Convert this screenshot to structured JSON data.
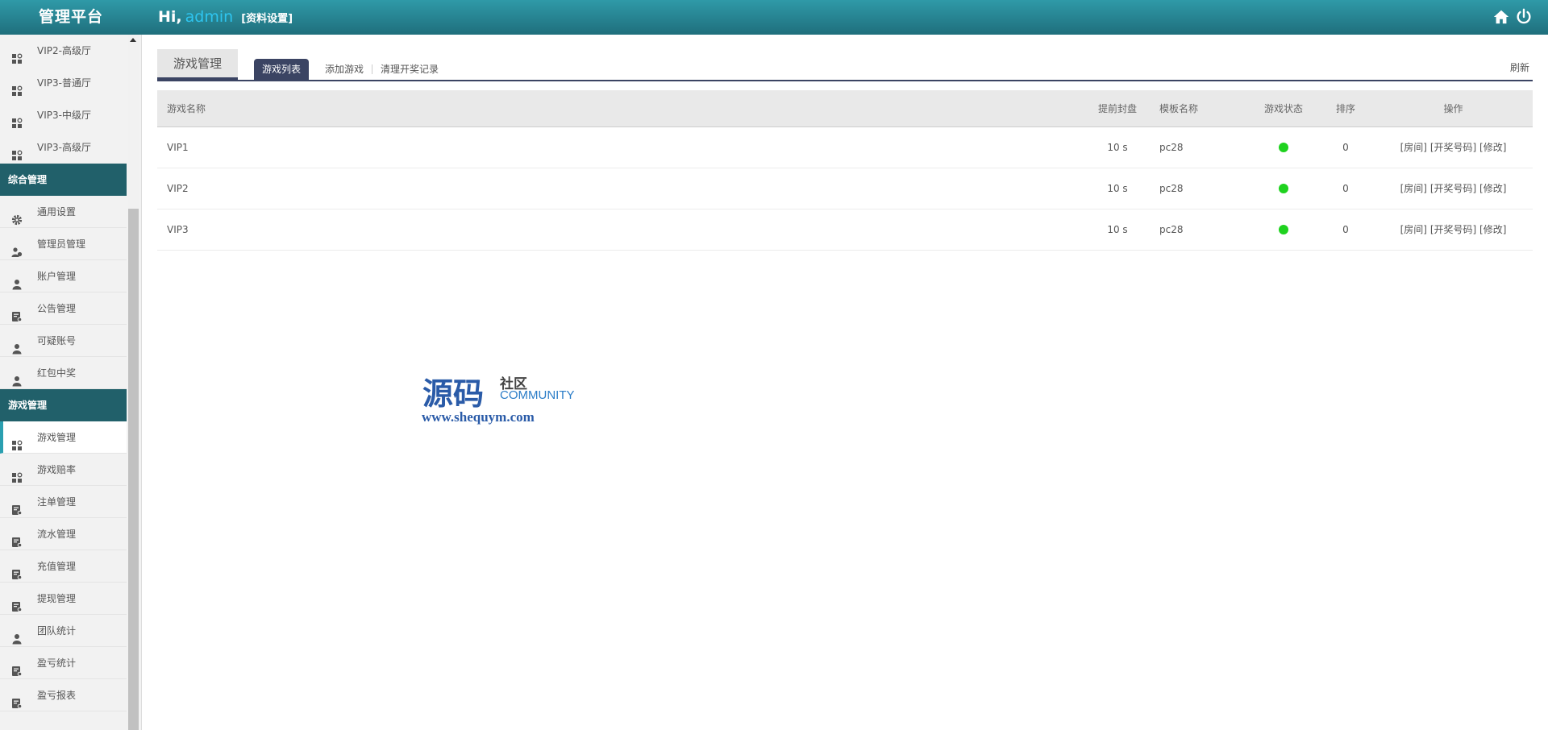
{
  "header": {
    "logo": "管理平台",
    "greeting": "Hi,",
    "username": "admin",
    "profile_link": "[资料设置]"
  },
  "sidebar": {
    "items_top": [
      {
        "label": "VIP2-高级厅",
        "icon": "grid-icon"
      },
      {
        "label": "VIP3-普通厅",
        "icon": "grid-icon"
      },
      {
        "label": "VIP3-中级厅",
        "icon": "grid-icon"
      },
      {
        "label": "VIP3-高级厅",
        "icon": "grid-icon"
      }
    ],
    "group1": "综合管理",
    "group1_items": [
      {
        "label": "通用设置",
        "icon": "gear-icon"
      },
      {
        "label": "管理员管理",
        "icon": "users-icon"
      },
      {
        "label": "账户管理",
        "icon": "user-icon"
      },
      {
        "label": "公告管理",
        "icon": "doc-icon"
      },
      {
        "label": "可疑账号",
        "icon": "user-icon"
      },
      {
        "label": "红包中奖",
        "icon": "user-icon"
      }
    ],
    "group2": "游戏管理",
    "group2_items": [
      {
        "label": "游戏管理",
        "icon": "grid-icon"
      },
      {
        "label": "游戏赔率",
        "icon": "grid-icon"
      },
      {
        "label": "注单管理",
        "icon": "doc-icon"
      },
      {
        "label": "流水管理",
        "icon": "doc-icon"
      },
      {
        "label": "充值管理",
        "icon": "doc-icon"
      },
      {
        "label": "提现管理",
        "icon": "doc-icon"
      },
      {
        "label": "团队统计",
        "icon": "user-icon"
      },
      {
        "label": "盈亏统计",
        "icon": "doc-icon"
      },
      {
        "label": "盈亏报表",
        "icon": "doc-icon"
      }
    ]
  },
  "main": {
    "title_tab": "游戏管理",
    "subtabs": [
      "游戏列表",
      "添加游戏",
      "清理开奖记录"
    ],
    "refresh": "刷新",
    "columns": [
      "游戏名称",
      "提前封盘",
      "模板名称",
      "游戏状态",
      "排序",
      "操作"
    ],
    "rows": [
      {
        "name": "VIP1",
        "close": "10 s",
        "template": "pc28",
        "status": "active",
        "sort": "0"
      },
      {
        "name": "VIP2",
        "close": "10 s",
        "template": "pc28",
        "status": "active",
        "sort": "0"
      },
      {
        "name": "VIP3",
        "close": "10 s",
        "template": "pc28",
        "status": "active",
        "sort": "0"
      }
    ],
    "ops": [
      "[房间]",
      "[开奖号码]",
      "[修改]"
    ],
    "status_color": "#1fd21f"
  },
  "watermark": {
    "main": "源码",
    "side1": "社区",
    "side2": "COMMUNITY",
    "url": "www.shequym.com"
  }
}
